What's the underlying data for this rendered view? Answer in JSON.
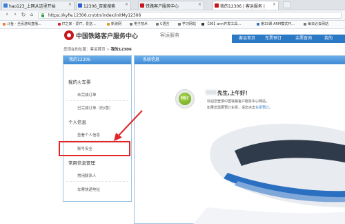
{
  "browser": {
    "tabs": [
      {
        "title": "hao123_上网从这里开始",
        "fav_color": "#3b82d6"
      },
      {
        "title": "12306_百度搜索",
        "fav_color": "#2f5fd0"
      },
      {
        "title": "铁路客户服务中心",
        "fav_color": "#c8161d"
      },
      {
        "title": "我的12306 | 客运服务 |",
        "fav_color": "#c8161d"
      }
    ],
    "address": "https://kyfw.12306.cn/otn/index/initMy12306",
    "bookmarks": [
      {
        "label": "斗鱼 - 全民游戏直播...",
        "color": "#f07a2a"
      },
      {
        "label": "IT之家 - 爱IT，爱这...",
        "color": "#d7262b"
      },
      {
        "label": "新浪网",
        "color": "#e59a1c"
      },
      {
        "label": "电子技术",
        "color": "#777777"
      },
      {
        "label": "C语言",
        "color": "#777777"
      },
      {
        "label": "学习网站",
        "color": "#777777"
      },
      {
        "label": "【36】arm开发工具...",
        "color": "#333333"
      },
      {
        "label": "第33课 ARM模式开...",
        "color": "#3b6fc2"
      },
      {
        "label": "每日必去网站",
        "color": "#777777"
      }
    ]
  },
  "site": {
    "logo_text": "中国铁路客户服务中心",
    "logo_sub": "客运服务",
    "top_nav": [
      "客运首页",
      "车票预订",
      "余票查询",
      "我的"
    ]
  },
  "breadcrumb": {
    "prefix": "您现在的位置：",
    "home": "客运首页",
    "sep": ">",
    "current": "我的12306"
  },
  "sidebar": {
    "header": "我的12306",
    "sections": [
      {
        "title": "我的火车票",
        "items": [
          "未完成订单",
          "已完成订单（历/惠）"
        ]
      },
      {
        "title": "个人信息",
        "items": [
          "查看个人信息",
          "账号安全"
        ]
      },
      {
        "title": "常用信息管理",
        "items": [
          "常用联系人",
          "车票快递地址"
        ]
      }
    ]
  },
  "main": {
    "header": "系统信息",
    "hi": "Hi!",
    "greeting": "先生,上午好！",
    "welcome": "欢迎您登录中国铁路客户服务中心网站。",
    "hint_prefix": "如果您需要预订车票，请您点击",
    "hint_link": "车票预订",
    "hint_suffix": "。"
  },
  "colors": {
    "accent_blue": "#2b78c4",
    "brand_red": "#c8161d",
    "highlight_red": "#e02626",
    "badge_green": "#7ab82a"
  }
}
